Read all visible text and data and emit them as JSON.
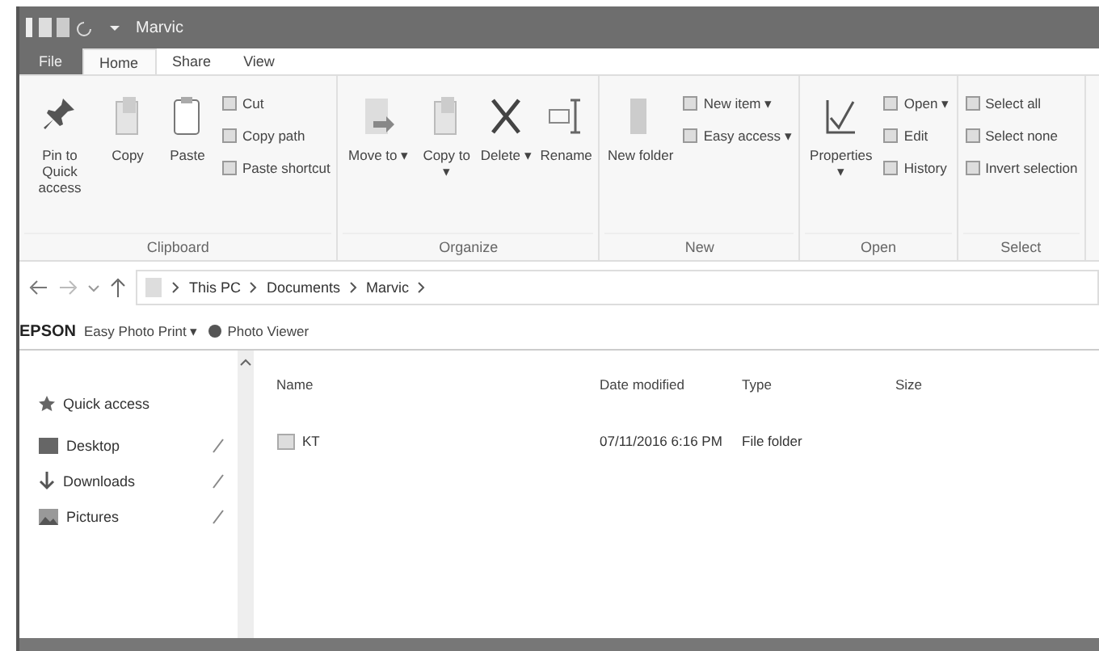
{
  "window": {
    "title": "Marvic"
  },
  "ribbon_tabs": [
    {
      "label": "File",
      "selected": false,
      "kind": "file"
    },
    {
      "label": "Home",
      "selected": true,
      "kind": "tab"
    },
    {
      "label": "Share",
      "selected": false,
      "kind": "tab"
    },
    {
      "label": "View",
      "selected": false,
      "kind": "tab"
    }
  ],
  "ribbon_groups": [
    {
      "label": "Clipboard",
      "items": [
        {
          "kind": "large",
          "label": "Pin to Quick access"
        },
        {
          "kind": "large",
          "label": "Copy"
        },
        {
          "kind": "large",
          "label": "Paste"
        },
        {
          "kind": "stack",
          "items": [
            "Cut",
            "Copy path",
            "Paste shortcut"
          ]
        }
      ]
    },
    {
      "label": "Organize",
      "items": [
        {
          "kind": "large",
          "label": "Move to ▾"
        },
        {
          "kind": "large",
          "label": "Copy to ▾"
        },
        {
          "kind": "large",
          "label": "Delete ▾"
        },
        {
          "kind": "large",
          "label": "Rename"
        }
      ]
    },
    {
      "label": "New",
      "items": [
        {
          "kind": "large",
          "label": "New folder"
        },
        {
          "kind": "stack",
          "items": [
            "New item ▾",
            "Easy access ▾"
          ]
        }
      ]
    },
    {
      "label": "Open",
      "items": [
        {
          "kind": "large",
          "label": "Properties ▾"
        },
        {
          "kind": "stack",
          "items": [
            "Open ▾",
            "Edit",
            "History"
          ]
        }
      ]
    },
    {
      "label": "Select",
      "items": [
        {
          "kind": "stack",
          "items": [
            "Select all",
            "Select none",
            "Invert selection"
          ]
        }
      ]
    }
  ],
  "address": {
    "path": [
      "This PC",
      "Documents",
      "Marvic"
    ]
  },
  "bookmarks": [
    {
      "label": "EPSON",
      "kind": "brand"
    },
    {
      "label": "Easy Photo Print ▾",
      "kind": "text"
    },
    {
      "label": "Photo Viewer",
      "kind": "viewer"
    }
  ],
  "sidebar": {
    "items": [
      {
        "label": "Quick access",
        "kind": "quick"
      },
      {
        "label": "Desktop",
        "kind": "desktop",
        "pinned": true
      },
      {
        "label": "Downloads",
        "kind": "downloads",
        "pinned": true
      },
      {
        "label": "Pictures",
        "kind": "pictures",
        "pinned": true
      }
    ]
  },
  "table": {
    "columns": [
      "Name",
      "Date modified",
      "Type",
      "Size"
    ],
    "rows": [
      {
        "name": "KT",
        "date": "07/11/2016 6:16 PM",
        "type": "File folder"
      }
    ]
  }
}
